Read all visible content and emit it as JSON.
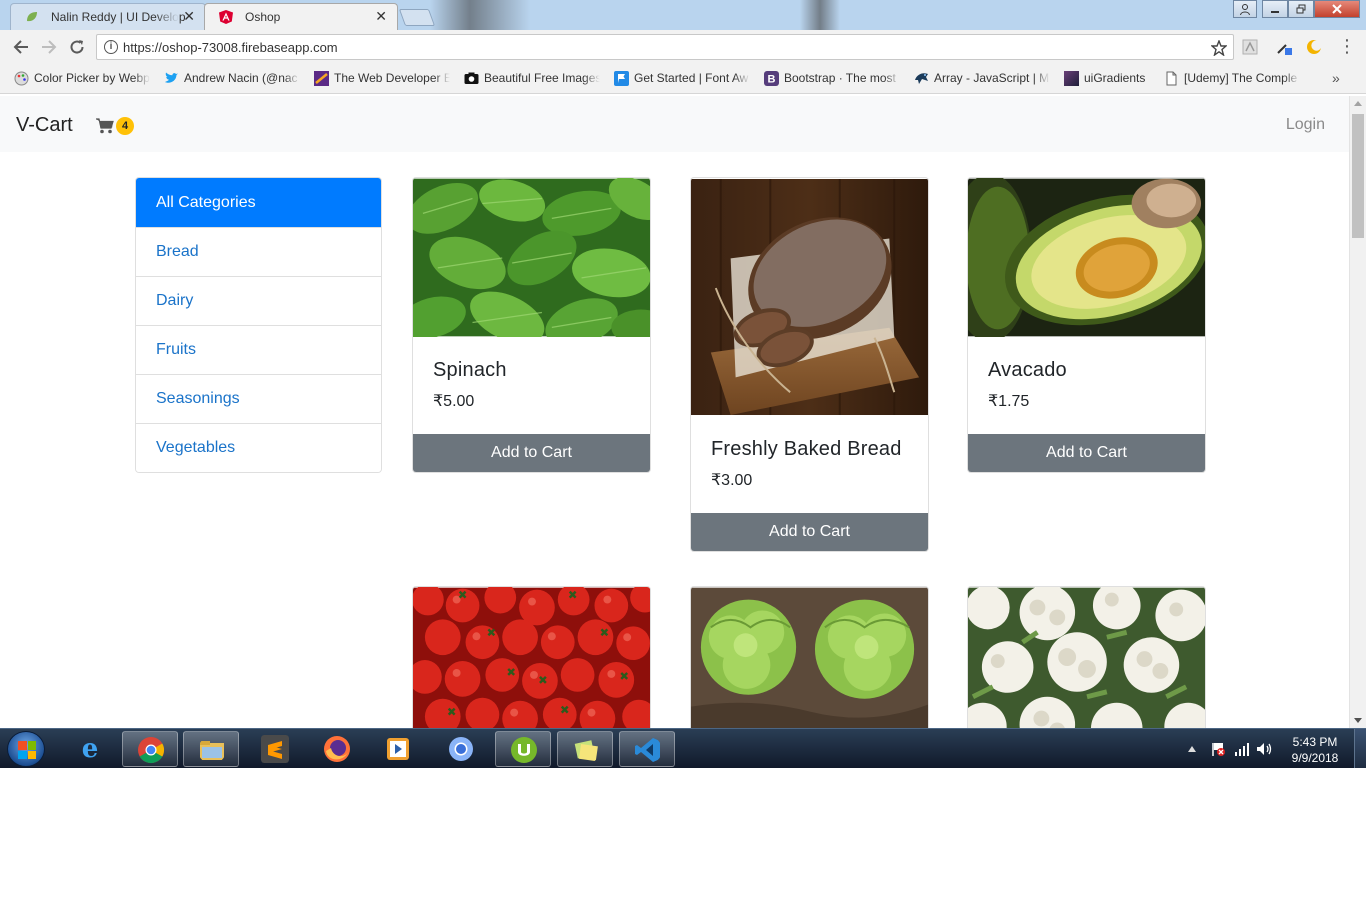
{
  "browser": {
    "tabs": [
      {
        "title": "Nalin Reddy | UI Develop",
        "active": false
      },
      {
        "title": "Oshop",
        "active": true
      }
    ],
    "url": "https://oshop-73008.firebaseapp.com",
    "bookmarks": [
      {
        "label": "Color Picker by Webp",
        "icon": "palette-icon"
      },
      {
        "label": "Andrew Nacin (@nac",
        "icon": "twitter-bird-icon"
      },
      {
        "label": "The Web Developer E",
        "icon": "webdev-icon"
      },
      {
        "label": "Beautiful Free Images",
        "icon": "camera-icon"
      },
      {
        "label": "Get Started | Font Aw",
        "icon": "flag-icon"
      },
      {
        "label": "Bootstrap · The most",
        "icon": "bootstrap-icon"
      },
      {
        "label": "Array - JavaScript | M",
        "icon": "mdn-icon"
      },
      {
        "label": "uiGradients",
        "icon": "gradient-icon"
      },
      {
        "label": "[Udemy] The Comple",
        "icon": "document-icon"
      }
    ],
    "bookmarks_more": "»",
    "close_glyph": "✕",
    "menu_glyph": "⋮"
  },
  "navbar": {
    "brand": "V-Cart",
    "cart_count": "4",
    "login": "Login"
  },
  "categories": [
    "All Categories",
    "Bread",
    "Dairy",
    "Fruits",
    "Seasonings",
    "Vegetables"
  ],
  "products": [
    {
      "title": "Spinach",
      "price": "₹5.00",
      "button": "Add to Cart",
      "image": "spinach-leaves"
    },
    {
      "title": "Freshly Baked Bread",
      "price": "₹3.00",
      "button": "Add to Cart",
      "image": "bread-loaf"
    },
    {
      "title": "Avacado",
      "price": "₹1.75",
      "button": "Add to Cart",
      "image": "avocado-halves"
    },
    {
      "image": "tomatoes"
    },
    {
      "image": "lettuce"
    },
    {
      "image": "cauliflower"
    }
  ],
  "taskbar": {
    "apps": [
      "windows-start",
      "internet-explorer",
      "chrome",
      "file-explorer",
      "sublime-text",
      "firefox",
      "media-player",
      "chrome-canary",
      "utorrent",
      "sticky-notes",
      "vscode"
    ],
    "time": "5:43 PM",
    "date": "9/9/2018"
  },
  "colors": {
    "primary": "#007bff",
    "link": "#1a73c9",
    "button_secondary": "#6c757d",
    "badge_warning": "#ffc107",
    "navbar_bg": "#f8f9fa"
  }
}
